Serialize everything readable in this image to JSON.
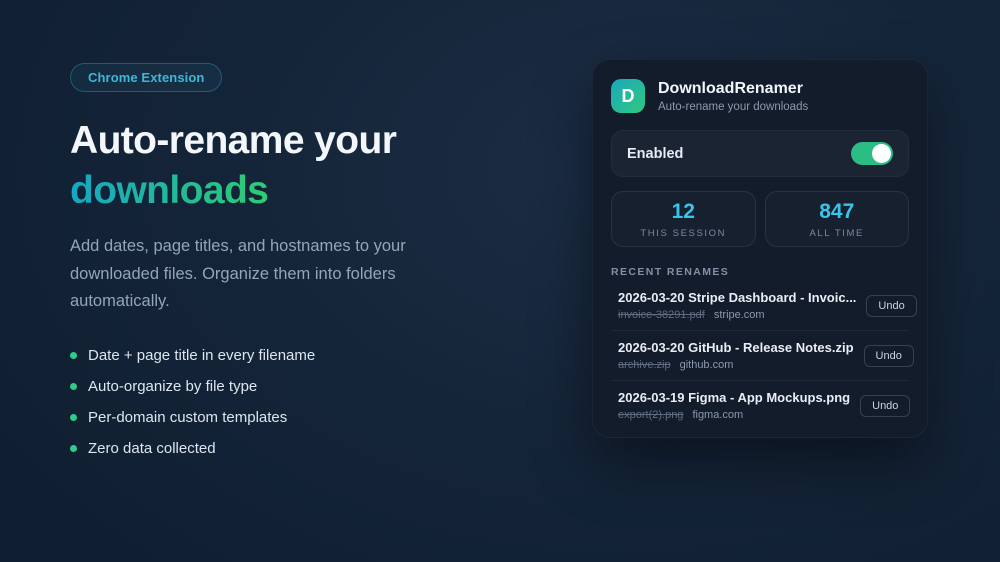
{
  "page": {
    "badge": "Chrome Extension",
    "title_line1": "Auto-rename your",
    "title_line2": "downloads",
    "description": "Add dates, page titles, and hostnames to your downloaded files. Organize them into folders automatically.",
    "features": [
      "Date + page title in every filename",
      "Auto-organize by file type",
      "Per-domain custom templates",
      "Zero data collected"
    ]
  },
  "popup": {
    "app_name": "DownloadRenamer",
    "app_icon_letter": "D",
    "tagline": "Auto-rename your downloads",
    "enabled_label": "Enabled",
    "toggle_state": "on",
    "stats": [
      {
        "value": "12",
        "label": "THIS SESSION"
      },
      {
        "value": "847",
        "label": "ALL TIME"
      }
    ],
    "recent_header": "RECENT RENAMES",
    "undo_label": "Undo",
    "renames": [
      {
        "new_name": "2026-03-20 Stripe Dashboard - Invoic...",
        "old_name": "invoice-38291.pdf",
        "host": "stripe.com"
      },
      {
        "new_name": "2026-03-20 GitHub - Release Notes.zip",
        "old_name": "archive.zip",
        "host": "github.com"
      },
      {
        "new_name": "2026-03-19 Figma - App Mockups.png",
        "old_name": "export(2).png",
        "host": "figma.com"
      }
    ]
  },
  "colors": {
    "background": "#152539",
    "card_background": "#131c2b",
    "accent_cyan": "#38c5ea",
    "toggle_green": "#2cbd85",
    "bullet_dot_green": "#2ecc87",
    "badge_teal": "#3eb8d8",
    "headline_gradient_start": "#17a6c4",
    "headline_gradient_end": "#2fcb72"
  }
}
